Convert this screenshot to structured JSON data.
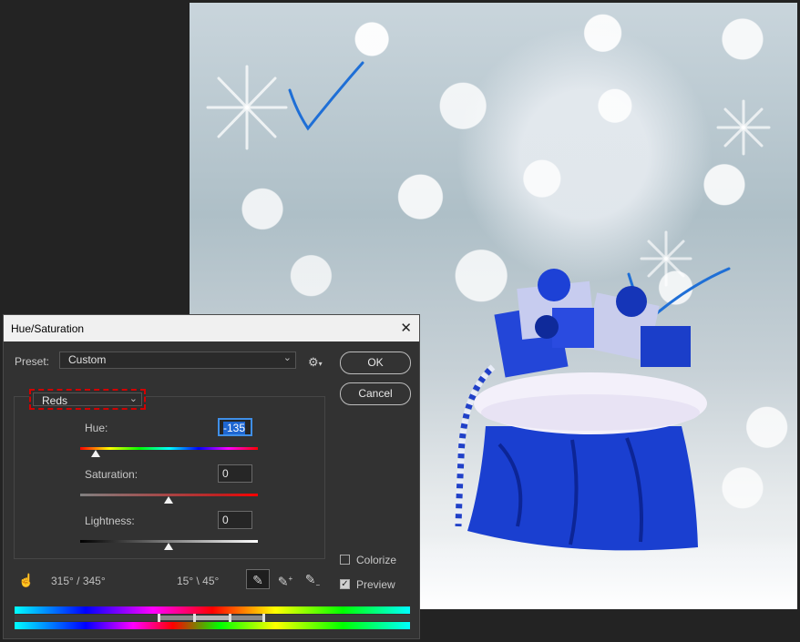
{
  "dialog": {
    "title": "Hue/Saturation",
    "preset_label": "Preset:",
    "preset_value": "Custom",
    "channel_value": "Reds",
    "ok_label": "OK",
    "cancel_label": "Cancel",
    "hue_label": "Hue:",
    "hue_value": "-135",
    "saturation_label": "Saturation:",
    "saturation_value": "0",
    "lightness_label": "Lightness:",
    "lightness_value": "0",
    "colorize_label": "Colorize",
    "colorize_checked": false,
    "preview_label": "Preview",
    "preview_checked": true,
    "range_left": "315° / 345°",
    "range_right": "15° \\ 45°",
    "icons": {
      "close": "close-icon",
      "gear": "gear-icon",
      "hand": "hand-adjust-icon",
      "eyedropper": "eyedropper-icon",
      "eyedropper_add": "eyedropper-add-icon",
      "eyedropper_subtract": "eyedropper-subtract-icon"
    }
  },
  "colors": {
    "focus_border": "#3f8fe8",
    "channel_highlight": "#d20000",
    "bag_blue": "#1a3fd0",
    "annotation_stroke": "#1f6fd6"
  }
}
